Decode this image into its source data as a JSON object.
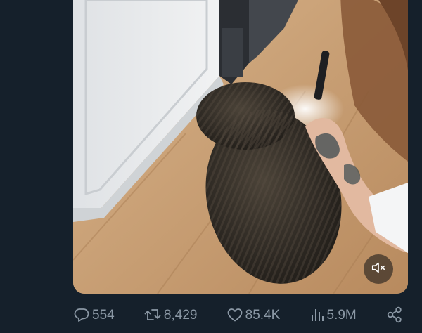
{
  "post": {
    "video": {
      "mute_icon": "speaker-muted-icon"
    },
    "actions": {
      "reply": {
        "icon": "reply-bubble-icon",
        "count": "554"
      },
      "repost": {
        "icon": "repost-icon",
        "count": "8,429"
      },
      "like": {
        "icon": "heart-icon",
        "count": "85.4K"
      },
      "views": {
        "icon": "views-bars-icon",
        "count": "5.9M"
      },
      "share": {
        "icon": "share-icon"
      }
    }
  },
  "colors": {
    "background": "#15202b",
    "icon_text": "#8b98a5",
    "accent": "#1d9bf0"
  }
}
